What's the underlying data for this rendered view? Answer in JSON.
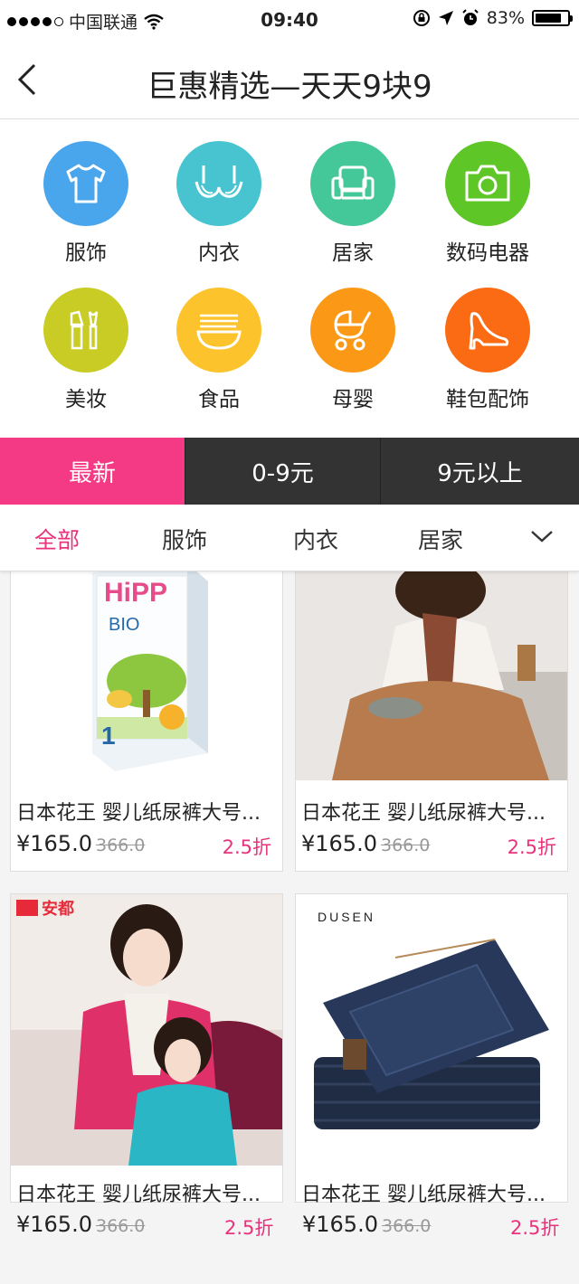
{
  "status_bar": {
    "carrier": "中国联通",
    "time": "09:40",
    "battery": "83%",
    "battery_level": 0.83
  },
  "nav": {
    "title": "巨惠精选—天天9块9"
  },
  "categories": [
    {
      "label": "服饰",
      "color": "#4aa6ec",
      "icon": "tshirt-icon"
    },
    {
      "label": "内衣",
      "color": "#47c4cf",
      "icon": "bra-icon"
    },
    {
      "label": "居家",
      "color": "#44c89a",
      "icon": "armchair-icon"
    },
    {
      "label": "数码电器",
      "color": "#5ec626",
      "icon": "camera-icon"
    },
    {
      "label": "美妆",
      "color": "#c8cc24",
      "icon": "makeup-icon"
    },
    {
      "label": "食品",
      "color": "#fcc32c",
      "icon": "bowl-icon"
    },
    {
      "label": "母婴",
      "color": "#fb9816",
      "icon": "stroller-icon"
    },
    {
      "label": "鞋包配饰",
      "color": "#fb6b14",
      "icon": "high-heel-icon"
    }
  ],
  "filter_tabs": [
    {
      "label": "最新",
      "active": true
    },
    {
      "label": "0-9元",
      "active": false
    },
    {
      "label": "9元以上",
      "active": false
    }
  ],
  "sub_tabs": [
    {
      "label": "全部",
      "active": true
    },
    {
      "label": "服饰",
      "active": false
    },
    {
      "label": "内衣",
      "active": false
    },
    {
      "label": "居家",
      "active": false
    }
  ],
  "products": [
    {
      "title": "日本花王 婴儿纸尿裤大号...",
      "price": "¥165.0",
      "old_price": "366.0",
      "discount": "2.5折",
      "brand_text": "HiPP",
      "image": "milk-powder-box"
    },
    {
      "title": "日本花王 婴儿纸尿裤大号...",
      "price": "¥165.0",
      "old_price": "366.0",
      "discount": "2.5折",
      "image": "lace-blouse-model"
    },
    {
      "title": "日本花王 婴儿纸尿裤大号...",
      "price": "¥165.0",
      "old_price": "366.0",
      "discount": "2.5折",
      "brand_text": "安都",
      "image": "cardigan-models"
    },
    {
      "title": "日本花王 婴儿纸尿裤大号...",
      "price": "¥165.0",
      "old_price": "366.0",
      "discount": "2.5折",
      "brand_text": "DUSEN",
      "image": "folded-jeans"
    }
  ],
  "colors": {
    "accent_pink": "#f43a84",
    "tab_dark": "#333333",
    "discount_pink": "#e8327c"
  }
}
